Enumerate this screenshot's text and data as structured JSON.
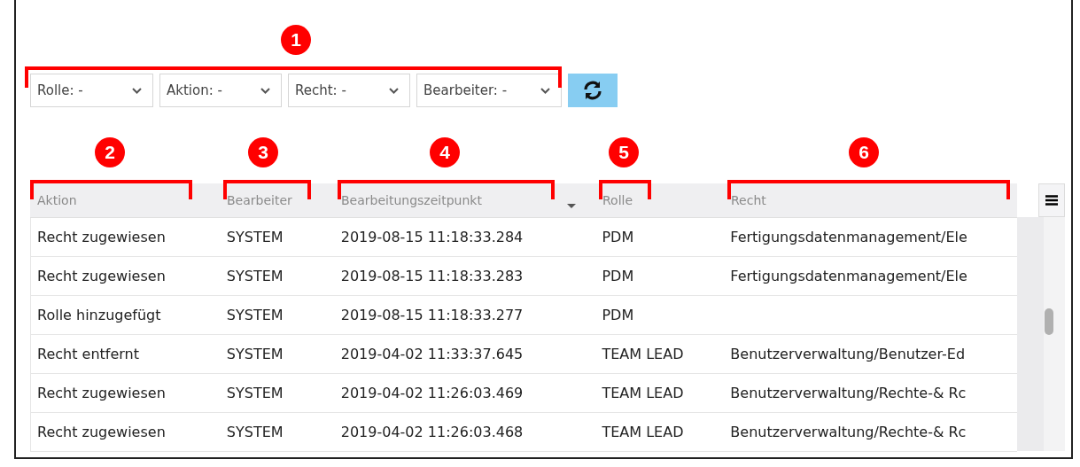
{
  "filters": [
    {
      "label": "Rolle: -"
    },
    {
      "label": "Aktion: -"
    },
    {
      "label": "Recht: -"
    },
    {
      "label": "Bearbeiter: -"
    }
  ],
  "table": {
    "columns": [
      {
        "label": "Aktion",
        "sorted": false
      },
      {
        "label": "Bearbeiter",
        "sorted": false
      },
      {
        "label": "Bearbeitungszeitpunkt",
        "sorted": true
      },
      {
        "label": "Rolle",
        "sorted": false
      },
      {
        "label": "Recht",
        "sorted": false
      }
    ],
    "rows": [
      {
        "cells": [
          "Recht zugewiesen",
          "SYSTEM",
          "2019-08-15 11:18:33.284",
          "PDM",
          "Fertigungsdatenmanagement/Ele"
        ]
      },
      {
        "cells": [
          "Recht zugewiesen",
          "SYSTEM",
          "2019-08-15 11:18:33.283",
          "PDM",
          "Fertigungsdatenmanagement/Ele"
        ]
      },
      {
        "cells": [
          "Rolle hinzugefügt",
          "SYSTEM",
          "2019-08-15 11:18:33.277",
          "PDM",
          ""
        ]
      },
      {
        "cells": [
          "Recht entfernt",
          "SYSTEM",
          "2019-04-02 11:33:37.645",
          "TEAM LEAD",
          "Benutzerverwaltung/Benutzer-Ed"
        ]
      },
      {
        "cells": [
          "Recht zugewiesen",
          "SYSTEM",
          "2019-04-02 11:26:03.469",
          "TEAM LEAD",
          "Benutzerverwaltung/Rechte-& Rc"
        ]
      },
      {
        "cells": [
          "Recht zugewiesen",
          "SYSTEM",
          "2019-04-02 11:26:03.468",
          "TEAM LEAD",
          "Benutzerverwaltung/Rechte-& Rc"
        ]
      }
    ]
  },
  "callouts": [
    {
      "number": "1"
    },
    {
      "number": "2"
    },
    {
      "number": "3"
    },
    {
      "number": "4"
    },
    {
      "number": "5"
    },
    {
      "number": "6"
    }
  ]
}
